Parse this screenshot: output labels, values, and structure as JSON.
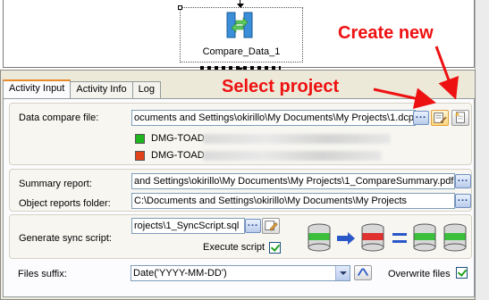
{
  "canvas": {
    "activity_label": "Compare_Data_1"
  },
  "annotations": {
    "create_new": "Create new",
    "select_project": "Select  project"
  },
  "tabs": [
    {
      "label": "Activity Input"
    },
    {
      "label": "Activity Info"
    },
    {
      "label": "Log"
    }
  ],
  "form": {
    "data_compare_file": {
      "label": "Data compare file:",
      "value": "ocuments and Settings\\okirillo\\My Documents\\My Projects\\1.dcp"
    },
    "connections": [
      {
        "name": "DMG-TOAD",
        "color": "#1fb51f"
      },
      {
        "name": "DMG-TOAD",
        "color": "#e3411a"
      }
    ],
    "summary_report": {
      "label": "Summary report:",
      "value": "and Settings\\okirillo\\My Documents\\My Projects\\1_CompareSummary.pdf"
    },
    "object_reports_folder": {
      "label": "Object reports folder:",
      "value": "C:\\Documents and Settings\\okirillo\\My Documents\\My Projects"
    },
    "generate_sync_script": {
      "label": "Generate sync script:",
      "value": "rojects\\1_SyncScript.sql",
      "execute_label": "Execute script",
      "execute_checked": true
    },
    "files_suffix": {
      "label": "Files suffix:",
      "value": "Date('YYYY-MM-DD')",
      "overwrite_label": "Overwrite files",
      "overwrite_checked": true
    }
  },
  "colors": {
    "annotation": "#ee1111",
    "tab_accent": "#e68b2c",
    "dialog_bg": "#ece9d8"
  }
}
